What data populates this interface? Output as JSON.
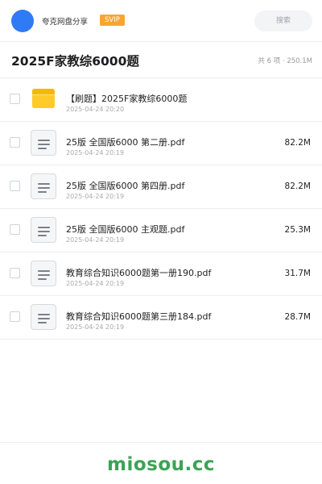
{
  "header": {
    "username": "夸克网盘分享",
    "badge": "SVIP",
    "search_placeholder": "搜索"
  },
  "folder": {
    "title": "2025F家教综6000题",
    "meta": "共 6 项 · 250.1M"
  },
  "files": [
    {
      "type": "folder",
      "icon": "folder-icon",
      "name": "【刷题】2025F家教综6000题",
      "date": "2025-04-24 20:20",
      "size": ""
    },
    {
      "type": "pdf",
      "icon": "document-icon",
      "name": "25版 全国版6000 第二册.pdf",
      "date": "2025-04-24 20:19",
      "size": "82.2M"
    },
    {
      "type": "pdf",
      "icon": "document-icon",
      "name": "25版 全国版6000 第四册.pdf",
      "date": "2025-04-24 20:19",
      "size": "82.2M"
    },
    {
      "type": "pdf",
      "icon": "document-icon",
      "name": "25版 全国版6000 主观题.pdf",
      "date": "2025-04-24 20:19",
      "size": "25.3M"
    },
    {
      "type": "pdf",
      "icon": "document-icon",
      "name": "教育综合知识6000题第一册190.pdf",
      "date": "2025-04-24 20:19",
      "size": "31.7M"
    },
    {
      "type": "pdf",
      "icon": "document-icon",
      "name": "教育综合知识6000题第三册184.pdf",
      "date": "2025-04-24 20:19",
      "size": "28.7M"
    }
  ],
  "watermark": "miosou.cc",
  "colors": {
    "avatar": "#2f7bf5",
    "badge": "#f7a531",
    "folder": "#ffcb29",
    "watermark": "#3aa455"
  }
}
